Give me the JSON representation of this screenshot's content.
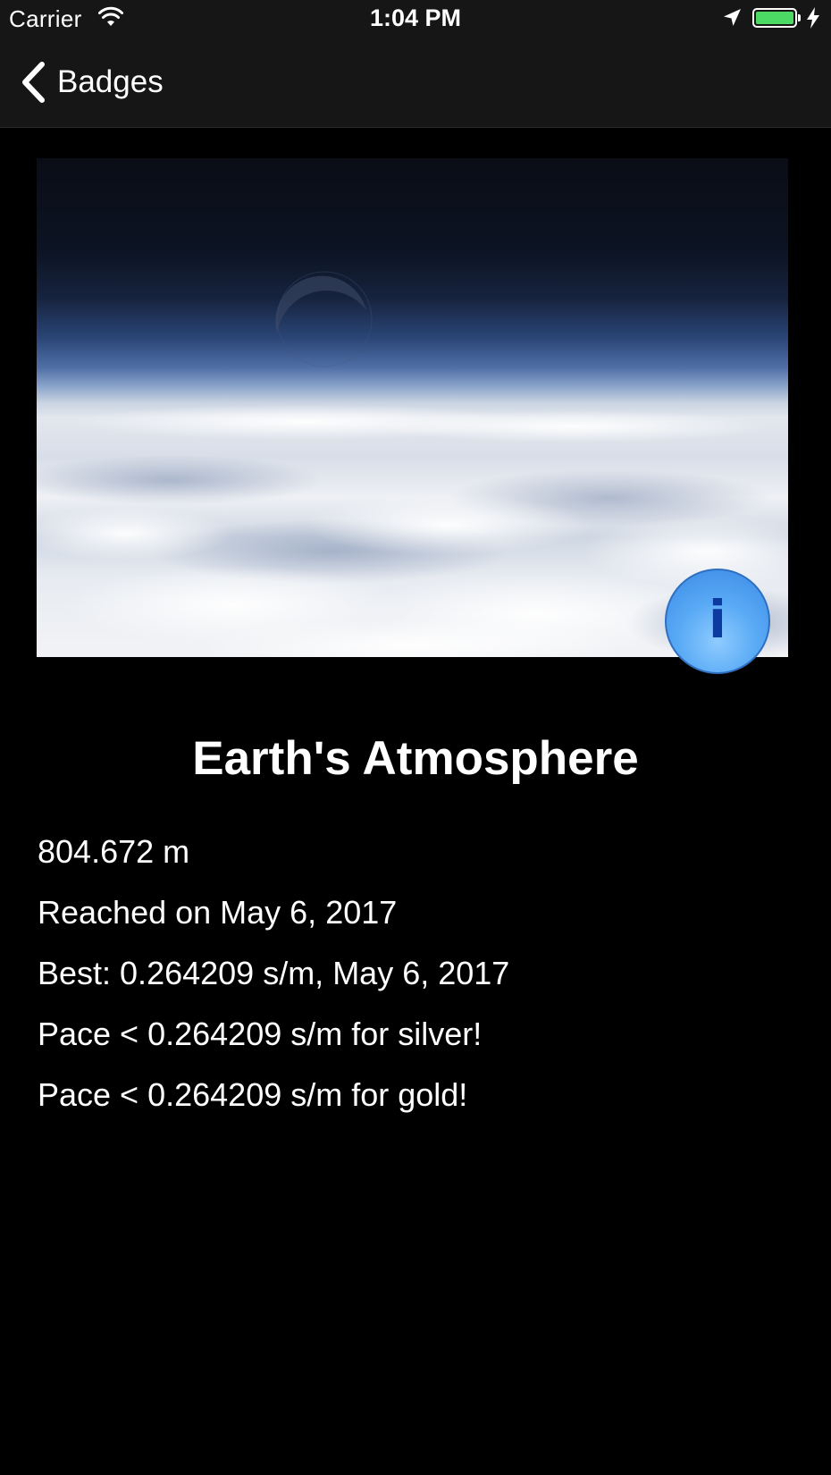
{
  "status_bar": {
    "carrier": "Carrier",
    "time": "1:04 PM",
    "battery_level": 1.0,
    "icons": [
      "wifi-icon",
      "location-arrow-icon",
      "battery-icon",
      "charging-bolt-icon"
    ]
  },
  "nav": {
    "back_label": "Badges",
    "back_icon": "chevron-left-icon"
  },
  "badge": {
    "image": "earth-atmosphere-photo",
    "info_icon": "info-icon",
    "info_glyph": "i",
    "title": "Earth's Atmosphere",
    "distance": "804.672 m",
    "reached": "Reached on May 6, 2017",
    "best": "Best: 0.264209 s/m, May 6, 2017",
    "silver": "Pace < 0.264209 s/m for silver!",
    "gold": "Pace < 0.264209 s/m for gold!"
  },
  "colors": {
    "background": "#000000",
    "bar": "#161616",
    "battery": "#4cd964",
    "info_button": "#59aaf5",
    "info_glyph": "#0d3aa0"
  }
}
